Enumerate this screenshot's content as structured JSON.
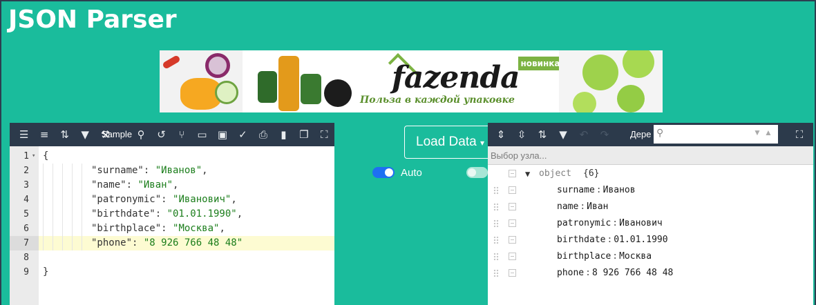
{
  "page": {
    "title": "JSON Parser"
  },
  "banner": {
    "brand": "fazenda",
    "slogan": "Польза в каждой упаковке",
    "badge": "новинка"
  },
  "editor": {
    "toolbar": {
      "format_icon": "format-icon",
      "compact_icon": "compact-icon",
      "sort_icon": "sort-icon",
      "filter_icon": "filter-icon",
      "repair_icon": "repair-icon",
      "sample_label": "Sample",
      "search_icon": "search-icon",
      "undo_icon": "history-icon",
      "transform_icon": "transform-icon",
      "open_icon": "folder-icon",
      "save_icon": "save-icon",
      "validate_icon": "check-icon",
      "print_icon": "print-icon",
      "delete_icon": "trash-icon",
      "copy_icon": "copy-icon",
      "fullscreen_icon": "fullscreen-icon"
    },
    "lines": [
      {
        "num": "1",
        "text": "{",
        "active": false,
        "fold": true
      },
      {
        "num": "2",
        "key": "\"surname\"",
        "val": "\"Иванов\"",
        "comma": ",",
        "active": false
      },
      {
        "num": "3",
        "key": "\"name\"",
        "val": "\"Иван\"",
        "comma": ",",
        "active": false
      },
      {
        "num": "4",
        "key": "\"patronymic\"",
        "val": "\"Иванович\"",
        "comma": ",",
        "active": false
      },
      {
        "num": "5",
        "key": "\"birthdate\"",
        "val": "\"01.01.1990\"",
        "comma": ",",
        "active": false
      },
      {
        "num": "6",
        "key": "\"birthplace\"",
        "val": "\"Москва\"",
        "comma": ",",
        "active": false
      },
      {
        "num": "7",
        "key": "\"phone\"",
        "val": "\"8 926 766 48 48\"",
        "comma": "",
        "active": true
      },
      {
        "num": "8",
        "text": "",
        "active": false
      },
      {
        "num": "9",
        "text": "}",
        "active": false
      }
    ]
  },
  "center": {
    "load_button": "Load Data",
    "auto_label": "Auto",
    "colors": {
      "toggle_on": "#1e6ff2",
      "toggle_off": "#a8e6d6"
    }
  },
  "tree": {
    "toolbar": {
      "expand_icon": "expand-all-icon",
      "collapse_icon": "collapse-all-icon",
      "sort_icon": "sort-icon",
      "filter_icon": "filter-icon",
      "undo_icon": "undo-icon",
      "redo_icon": "redo-icon",
      "mode_label": "Дере",
      "fullscreen_icon": "fullscreen-icon"
    },
    "breadcrumb": "Выбор узла...",
    "root": {
      "type": "object",
      "count": "{6}"
    },
    "fields": [
      {
        "key": "surname",
        "value": "Иванов"
      },
      {
        "key": "name",
        "value": "Иван"
      },
      {
        "key": "patronymic",
        "value": "Иванович"
      },
      {
        "key": "birthdate",
        "value": "01.01.1990"
      },
      {
        "key": "birthplace",
        "value": "Москва"
      },
      {
        "key": "phone",
        "value": "8 926 766 48 48"
      }
    ]
  },
  "colors": {
    "background": "#1abc9c",
    "toolbar": "#2c3a4b",
    "string": "#1a7d1a",
    "active_line": "#fdfbd2"
  }
}
